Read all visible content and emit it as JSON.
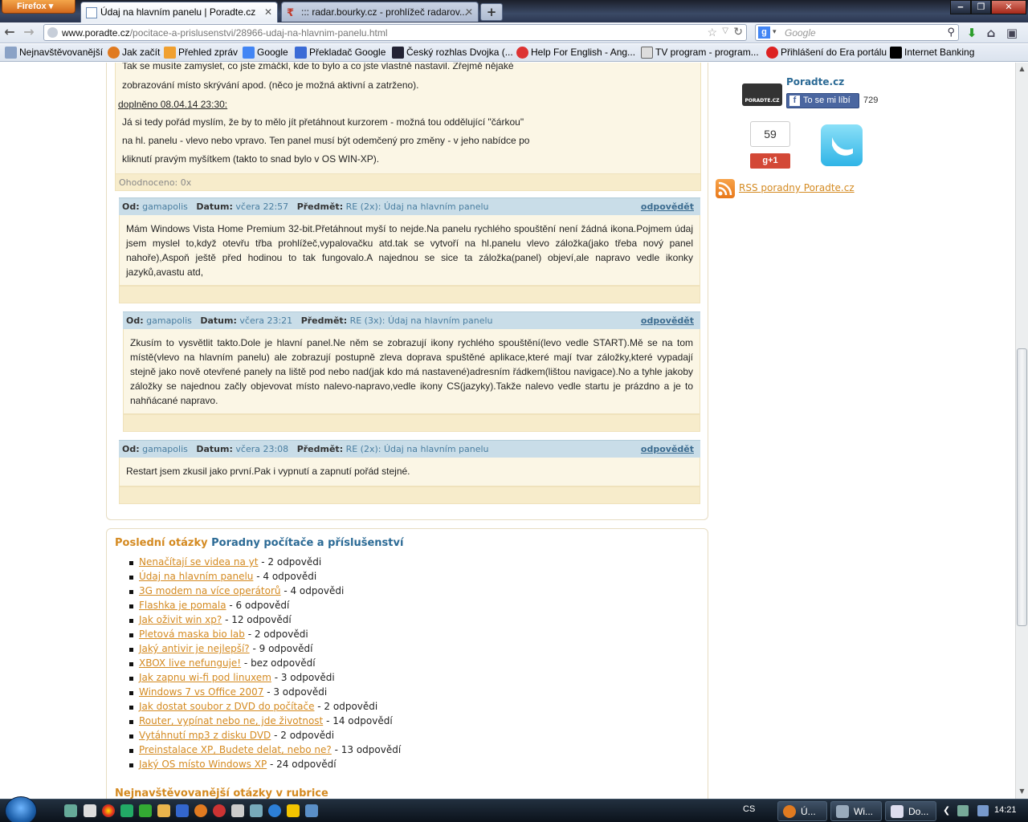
{
  "browser": {
    "menu_button": "Firefox",
    "tabs": [
      {
        "label": "Údaj na hlavním panelu | Poradte.cz",
        "active": true
      },
      {
        "label": "::: radar.bourky.cz - prohlížeč radarov...",
        "active": false
      }
    ],
    "url_domain": "www.poradte.cz",
    "url_path": "/pocitace-a-prislusenstvi/28966-udaj-na-hlavnim-panelu.html",
    "search_placeholder": "Google",
    "bookmarks": [
      "Nejnavštěvovanější",
      "Jak začít",
      "Přehled zpráv",
      "Google",
      "Překladač Google",
      "Český rozhlas Dvojka (...",
      "Help For English - Ang...",
      "TV program - program...",
      "Přihlášení do Era portálu",
      "Internet Banking"
    ]
  },
  "first_post": {
    "lines": [
      "Tak se musíte zamyslet, co jste zmáčkl, kde to bylo a co jste vlastně nastavil. Zřejmě nějaké",
      "zobrazování místo skrývání apod. (něco je možná aktivní a zatrženo)."
    ],
    "addendum_label": "doplněno 08.04.14 23:30:",
    "addendum_lines": [
      "Já si tedy pořád myslím, že by to mělo jít přetáhnout kurzorem - možná tou oddělující \"čárkou\"",
      "na hl. panelu - vlevo nebo vpravo. Ten panel musí být odemčený pro změny - v jeho nabídce po",
      "kliknutí pravým myšítkem (takto to snad bylo v OS WIN-XP)."
    ],
    "rating": "Ohodnoceno: 0x"
  },
  "labels": {
    "from": "Od:",
    "date": "Datum:",
    "subject": "Předmět:",
    "reply": "odpovědět"
  },
  "comments": [
    {
      "author": "gamapolis",
      "date": "včera 22:57",
      "subject": "RE (2x): Údaj na hlavním panelu",
      "body": "Mám Windows Vista Home Premium 32-bit.Přetáhnout myší to nejde.Na panelu rychlého spouštění není žádná ikona.Pojmem údaj jsem myslel to,když otevřu třba prohlížeč,vypalovačku atd.tak se vytvoří na hl.panelu vlevo záložka(jako třeba nový panel nahoře),Aspoň ještě před hodinou to tak fungovalo.A najednou se sice ta záložka(panel) objeví,ale napravo vedle ikonky jazyků,avastu atd,"
    },
    {
      "author": "gamapolis",
      "date": "včera 23:21",
      "subject": "RE (3x): Údaj na hlavním panelu",
      "body": "Zkusím to vysvětlit takto.Dole je hlavní panel.Ne něm se zobrazují ikony rychlého spouštění(levo vedle START).Mě se na tom místě(vlevo na hlavním panelu) ale zobrazují postupně zleva doprava spuštěné aplikace,které mají tvar záložky,které vypadají stejně jako nově otevřené panely na liště pod nebo nad(jak kdo má nastavené)adresním řádkem(lištou navigace).No a tyhle jakoby záložky se najednou začly objevovat místo nalevo-napravo,vedle ikony CS(jazyky).Takže nalevo vedle startu je prázdno a je to nahňácané napravo."
    },
    {
      "author": "gamapolis",
      "date": "včera 23:08",
      "subject": "RE (2x): Údaj na hlavním panelu",
      "body": "Restart jsem zkusil jako první.Pak i vypnutí a zapnutí pořád stejné."
    }
  ],
  "latest": {
    "title_a": "Poslední otázky",
    "title_b": "Poradny počítače a příslušenství",
    "items": [
      {
        "q": "Nenačítají se videa na yt",
        "a": " - 2 odpovědi"
      },
      {
        "q": "Údaj na hlavním panelu",
        "a": " - 4 odpovědi"
      },
      {
        "q": "3G modem na více operátorů",
        "a": " - 4 odpovědi"
      },
      {
        "q": "Flashka je pomala",
        "a": " - 6 odpovědí"
      },
      {
        "q": "Jak oživit win xp?",
        "a": " - 12 odpovědí"
      },
      {
        "q": "Pletová maska bio lab",
        "a": " - 2 odpovědi"
      },
      {
        "q": "Jaký antivir je nejlepší?",
        "a": " - 9 odpovědí"
      },
      {
        "q": "XBOX live nefunguje!",
        "a": " - bez odpovědí"
      },
      {
        "q": "Jak zapnu wi-fi pod linuxem",
        "a": " - 3 odpovědi"
      },
      {
        "q": "Windows 7 vs Office 2007",
        "a": " - 3 odpovědi"
      },
      {
        "q": "Jak dostat soubor z DVD do počítače",
        "a": " - 2 odpovědi"
      },
      {
        "q": "Router, vypínat nebo ne, jde životnost",
        "a": " - 14 odpovědí"
      },
      {
        "q": "Vytáhnutí mp3 z disku DVD",
        "a": " - 2 odpovědi"
      },
      {
        "q": "Preinstalace XP, Budete delat, nebo ne?",
        "a": " - 13 odpovědí"
      },
      {
        "q": "Jaký OS místo Windows XP",
        "a": " - 24 odpovědí"
      }
    ],
    "next_title": "Nejnavštěvovanější otázky v rubrice"
  },
  "sidebar": {
    "site_name": "Poradte.cz",
    "logo_text": "PORADTE.CZ",
    "fb_like": "To se mi líbí",
    "fb_count": "729",
    "gplus_count": "59",
    "gplus_label": "g+1",
    "rss_link": "RSS poradny Poradte.cz"
  },
  "taskbar": {
    "windows": [
      "Ú...",
      "Wi...",
      "Do..."
    ],
    "lang": "CS",
    "time": "14:21"
  },
  "colors": {
    "accent_orange": "#d48a21",
    "accent_blue": "#2b6a95",
    "comment_bg": "#fbf6e5",
    "header_bg": "#c9dde8"
  }
}
